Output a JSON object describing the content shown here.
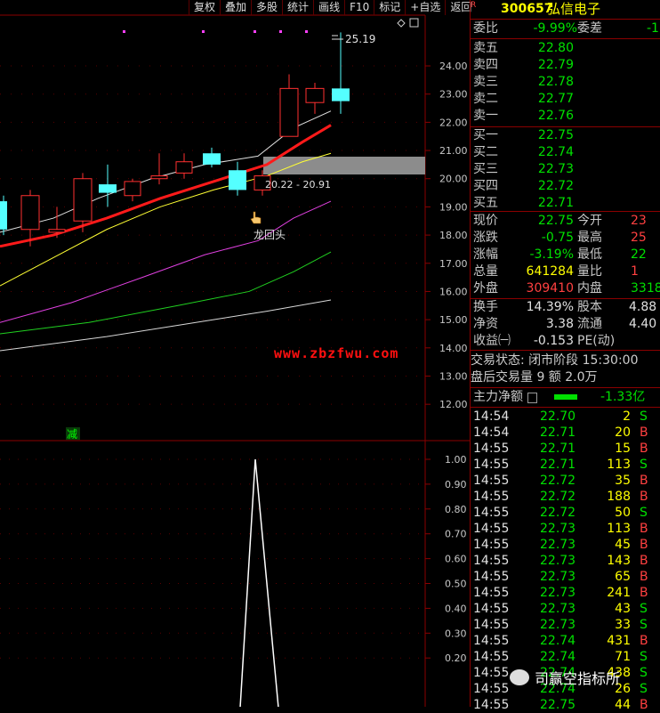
{
  "toolbar": [
    "复权",
    "叠加",
    "多股",
    "统计",
    "画线",
    "F10",
    "标记",
    "+自选",
    "返回"
  ],
  "chart": {
    "price_axis": [
      "24.00",
      "23.00",
      "22.00",
      "21.00",
      "20.00",
      "19.00",
      "18.00",
      "17.00",
      "16.00",
      "15.00",
      "14.00",
      "13.00",
      "12.00"
    ],
    "indicator_axis": [
      "1.00",
      "0.90",
      "0.80",
      "0.70",
      "0.60",
      "0.50",
      "0.40",
      "0.30",
      "0.20"
    ],
    "high_label": "25.19",
    "zone_label": "20.22 - 20.91",
    "signal_label": "龙回头",
    "indicator_tag": "减",
    "watermark": "www.zbzfwu.com"
  },
  "chart_data": {
    "type": "candlestick",
    "price_range": [
      11.5,
      25.8
    ],
    "candles": [
      {
        "o": 18.2,
        "c": 19.2,
        "h": 19.4,
        "l": 18.0,
        "up": false
      },
      {
        "o": 18.2,
        "c": 19.4,
        "h": 19.6,
        "l": 17.6,
        "up": true
      },
      {
        "o": 18.1,
        "c": 18.2,
        "h": 19.0,
        "l": 17.9,
        "up": true
      },
      {
        "o": 18.5,
        "c": 20.0,
        "h": 20.2,
        "l": 18.1,
        "up": true
      },
      {
        "o": 19.8,
        "c": 19.5,
        "h": 20.5,
        "l": 19.0,
        "up": false
      },
      {
        "o": 19.4,
        "c": 19.9,
        "h": 20.0,
        "l": 19.2,
        "up": true
      },
      {
        "o": 20.0,
        "c": 20.1,
        "h": 20.9,
        "l": 19.8,
        "up": true
      },
      {
        "o": 20.2,
        "c": 20.6,
        "h": 20.9,
        "l": 20.0,
        "up": true
      },
      {
        "o": 20.9,
        "c": 20.5,
        "h": 21.1,
        "l": 20.4,
        "up": false
      },
      {
        "o": 20.3,
        "c": 19.6,
        "h": 20.6,
        "l": 19.4,
        "up": false
      },
      {
        "o": 19.6,
        "c": 20.1,
        "h": 20.3,
        "l": 19.4,
        "up": true
      },
      {
        "o": 21.5,
        "c": 23.2,
        "h": 23.7,
        "l": 21.5,
        "up": true
      },
      {
        "o": 22.7,
        "c": 23.2,
        "h": 23.4,
        "l": 22.3,
        "up": true
      },
      {
        "o": 23.2,
        "c": 22.75,
        "h": 25.19,
        "l": 22.3,
        "up": false
      }
    ],
    "indicator_range": [
      0,
      1.0
    ],
    "indicator_points": [
      [
        270,
        0
      ],
      [
        287,
        1.0
      ],
      [
        313,
        0
      ]
    ]
  },
  "quote": {
    "code": "300657",
    "name": "弘信电子",
    "ratio_label": "委比",
    "ratio_value": "-9.99%",
    "diff_label": "委差",
    "diff_value": "-1",
    "asks": [
      {
        "label": "卖五",
        "price": "22.80"
      },
      {
        "label": "卖四",
        "price": "22.79"
      },
      {
        "label": "卖三",
        "price": "22.78"
      },
      {
        "label": "卖二",
        "price": "22.77"
      },
      {
        "label": "卖一",
        "price": "22.76"
      }
    ],
    "bids": [
      {
        "label": "买一",
        "price": "22.75"
      },
      {
        "label": "买二",
        "price": "22.74"
      },
      {
        "label": "买三",
        "price": "22.73"
      },
      {
        "label": "买四",
        "price": "22.72"
      },
      {
        "label": "买五",
        "price": "22.71"
      }
    ],
    "stats": [
      {
        "l1": "现价",
        "v1": "22.75",
        "c1": "grn",
        "l2": "今开",
        "v2": "23",
        "c2": "red"
      },
      {
        "l1": "涨跌",
        "v1": "-0.75",
        "c1": "grn",
        "l2": "最高",
        "v2": "25",
        "c2": "red"
      },
      {
        "l1": "涨幅",
        "v1": "-3.19%",
        "c1": "grn",
        "l2": "最低",
        "v2": "22",
        "c2": "grn"
      },
      {
        "l1": "总量",
        "v1": "641284",
        "c1": "yel",
        "l2": "量比",
        "v2": "1",
        "c2": "red"
      },
      {
        "l1": "外盘",
        "v1": "309410",
        "c1": "red",
        "l2": "内盘",
        "v2": "3318",
        "c2": "grn"
      }
    ],
    "stats2": [
      {
        "l1": "换手",
        "v1": "14.39%",
        "l2": "股本",
        "v2": "4.88"
      },
      {
        "l1": "净资",
        "v1": "3.38",
        "l2": "流通",
        "v2": "4.40"
      },
      {
        "l1": "收益㈠",
        "v1": "-0.153",
        "l2": "PE(动)",
        "v2": ""
      }
    ],
    "status_line": "交易状态: 闭市阶段 15:30:00",
    "after_line": "盘后交易量 9 额 2.0万",
    "main_flow_label": "主力净额",
    "main_flow_value": "-1.33亿"
  },
  "ticks": [
    {
      "t": "14:54",
      "p": "22.70",
      "v": "2",
      "s": "S"
    },
    {
      "t": "14:54",
      "p": "22.71",
      "v": "20",
      "s": "B"
    },
    {
      "t": "14:55",
      "p": "22.71",
      "v": "15",
      "s": "B"
    },
    {
      "t": "14:55",
      "p": "22.71",
      "v": "113",
      "s": "S"
    },
    {
      "t": "14:55",
      "p": "22.72",
      "v": "35",
      "s": "B"
    },
    {
      "t": "14:55",
      "p": "22.72",
      "v": "188",
      "s": "B"
    },
    {
      "t": "14:55",
      "p": "22.72",
      "v": "50",
      "s": "S"
    },
    {
      "t": "14:55",
      "p": "22.73",
      "v": "113",
      "s": "B"
    },
    {
      "t": "14:55",
      "p": "22.73",
      "v": "45",
      "s": "B"
    },
    {
      "t": "14:55",
      "p": "22.73",
      "v": "143",
      "s": "B"
    },
    {
      "t": "14:55",
      "p": "22.73",
      "v": "65",
      "s": "B"
    },
    {
      "t": "14:55",
      "p": "22.73",
      "v": "241",
      "s": "B"
    },
    {
      "t": "14:55",
      "p": "22.73",
      "v": "43",
      "s": "S"
    },
    {
      "t": "14:55",
      "p": "22.73",
      "v": "33",
      "s": "S"
    },
    {
      "t": "14:55",
      "p": "22.74",
      "v": "431",
      "s": "B"
    },
    {
      "t": "14:55",
      "p": "22.74",
      "v": "71",
      "s": "S"
    },
    {
      "t": "14:55",
      "p": "22.74",
      "v": "438",
      "s": "S"
    },
    {
      "t": "14:55",
      "p": "22.74",
      "v": "26",
      "s": "S"
    },
    {
      "t": "14:55",
      "p": "22.75",
      "v": "44",
      "s": "B"
    }
  ],
  "wechat_label": "司赢空指标所"
}
